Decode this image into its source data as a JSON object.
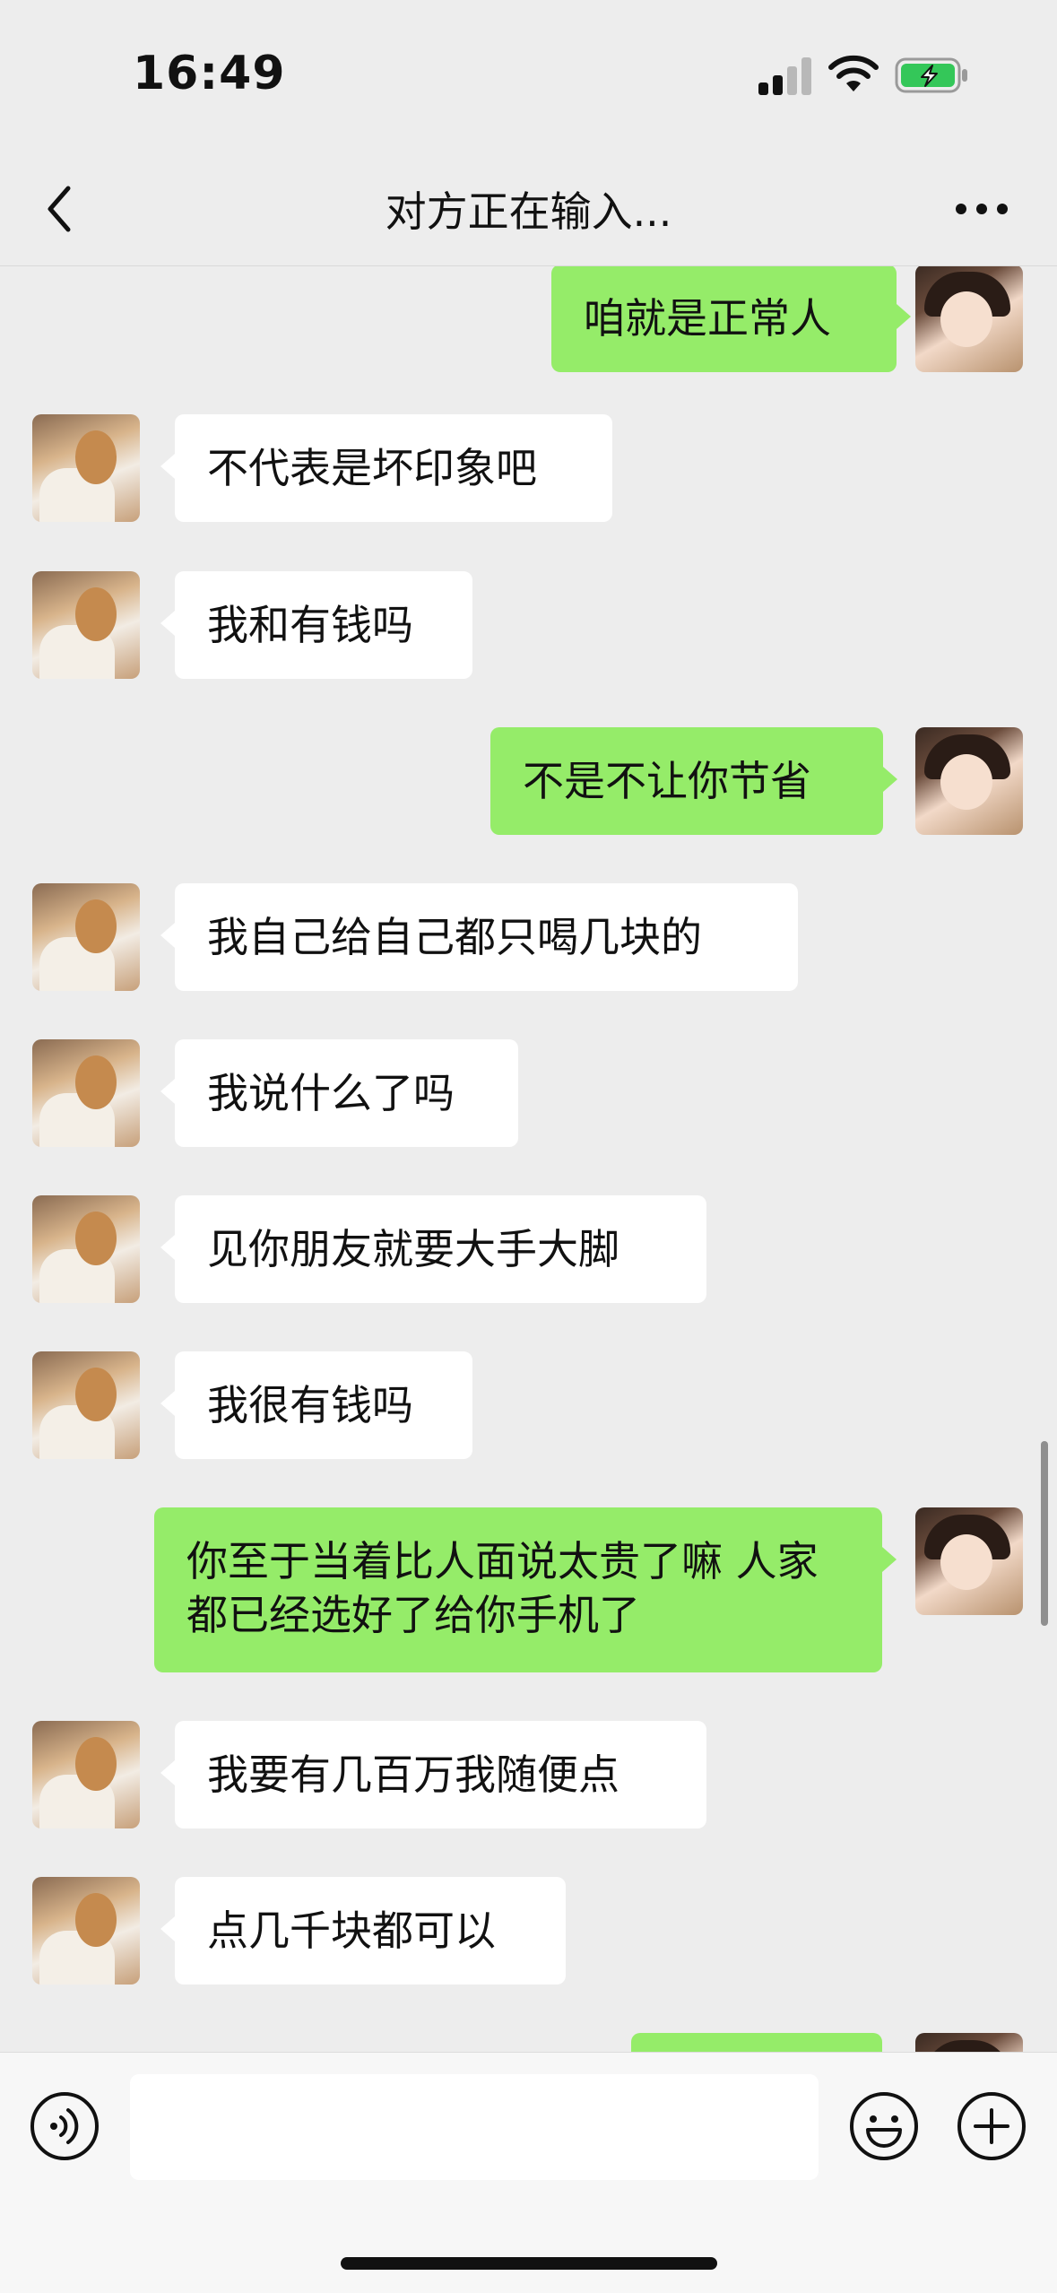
{
  "status_bar": {
    "time": "16:49",
    "icons": [
      "cellular-signal-icon",
      "wifi-icon",
      "battery-charging-icon"
    ],
    "battery_color": "#34c759"
  },
  "nav": {
    "title": "对方正在输入...",
    "back_icon": "chevron-left-icon",
    "more_icon": "more-dots-icon"
  },
  "colors": {
    "background": "#ededed",
    "outgoing_bubble": "#95ec69",
    "incoming_bubble": "#ffffff"
  },
  "messages": [
    {
      "side": "out",
      "text": "咱就是正常人"
    },
    {
      "side": "in",
      "text": "不代表是坏印象吧"
    },
    {
      "side": "in",
      "text": "我和有钱吗"
    },
    {
      "side": "out",
      "text": "不是不让你节省"
    },
    {
      "side": "in",
      "text": "我自己给自己都只喝几块的"
    },
    {
      "side": "in",
      "text": "我说什么了吗"
    },
    {
      "side": "in",
      "text": "见你朋友就要大手大脚"
    },
    {
      "side": "in",
      "text": "我很有钱吗"
    },
    {
      "side": "out",
      "text": "你至于当着比人面说太贵了嘛 人家都已经选好了给你手机了"
    },
    {
      "side": "in",
      "text": "我要有几百万我随便点"
    },
    {
      "side": "in",
      "text": "点几千块都可以"
    },
    {
      "side": "out",
      "text": ""
    }
  ],
  "input_bar": {
    "voice_icon": "voice-icon",
    "placeholder": "",
    "emoji_icon": "emoji-icon",
    "plus_icon": "plus-icon"
  }
}
